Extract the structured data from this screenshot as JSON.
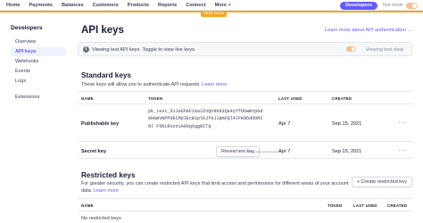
{
  "nav": {
    "items": [
      "Home",
      "Payments",
      "Balances",
      "Customers",
      "Products",
      "Reports",
      "Connect",
      "More"
    ],
    "developers_label": "Developers",
    "test_mode_label": "Test mode"
  },
  "test_badge": "TEST DATA",
  "sidebar": {
    "title": "Developers",
    "items": [
      "Overview",
      "API keys",
      "Webhooks",
      "Events",
      "Logs",
      "Extensions"
    ],
    "active_index": 1
  },
  "page": {
    "title": "API keys",
    "learn_more_link": "Learn more about API authentication →"
  },
  "banner": {
    "text": "Viewing test API keys. Toggle to view live keys.",
    "toggle_label": "Viewing test data"
  },
  "standard": {
    "title": "Standard keys",
    "desc": "These keys will allow you to authenticate API requests.",
    "learn_more": "Learn more",
    "columns": [
      "NAME",
      "TOKEN",
      "LAST USED",
      "CREATED"
    ],
    "rows": [
      {
        "name": "Publishable key",
        "token": "pk_test_51Ja6hAFi6a2ZnQn9b83Qa4yffDbwmYpGd\n0HGmVNPP0ECMUIEcB1plKJY9JJpmFQl4lFKN5dd0RI\nNl F5NLRxzoiA00gXggBITq",
        "last_used": "Apr 7",
        "created": "Sep 15, 2021"
      },
      {
        "name": "Secret key",
        "token": "••••••••••••••••",
        "reveal_label": "Reveal test key",
        "last_used": "Apr 7",
        "created": "Sep 15, 2021"
      }
    ]
  },
  "restricted": {
    "title": "Restricted keys",
    "desc_line1": "For greater security, you can create restricted API keys that limit access and permissions for different areas of your",
    "desc_line2": "account data.",
    "learn_more": "Learn more",
    "create_button": "+ Create restricted key",
    "columns": [
      "NAME",
      "TOKEN",
      "LAST USED",
      "CREATED"
    ],
    "empty_text": "No restricted keys"
  },
  "colors": {
    "accent": "#635bff",
    "test_orange": "#f5a623"
  }
}
